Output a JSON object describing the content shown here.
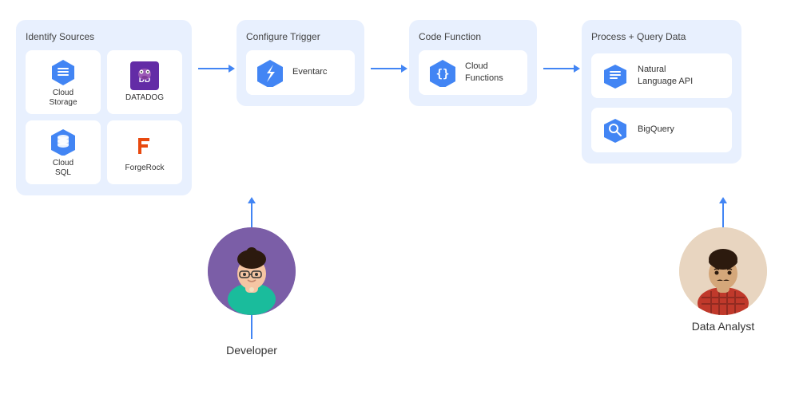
{
  "stages": {
    "identify": {
      "label": "Identify Sources",
      "sources": [
        {
          "name": "Cloud\nStorage",
          "type": "cloud-storage"
        },
        {
          "name": "Datadog",
          "type": "datadog"
        },
        {
          "name": "Cloud\nSQL",
          "type": "cloud-sql"
        },
        {
          "name": "ForgeRock",
          "type": "forgerock"
        }
      ]
    },
    "trigger": {
      "label": "Configure Trigger",
      "item": "Eventarc",
      "type": "eventarc"
    },
    "function": {
      "label": "Code Function",
      "item": "Cloud\nFunctions",
      "type": "cloud-functions"
    },
    "process": {
      "label": "Process + Query Data",
      "items": [
        {
          "name": "Natural\nLanguage API",
          "type": "nl-api"
        },
        {
          "name": "BigQuery",
          "type": "bigquery"
        }
      ]
    }
  },
  "personas": [
    {
      "name": "Developer",
      "type": "developer"
    },
    {
      "name": "Data Analyst",
      "type": "analyst"
    }
  ],
  "colors": {
    "blue": "#4285f4",
    "box_bg": "#e8f0fe",
    "white": "#ffffff"
  }
}
